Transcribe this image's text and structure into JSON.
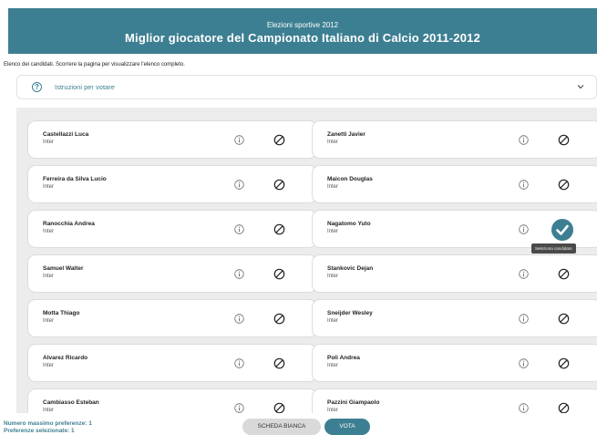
{
  "header": {
    "subtitle": "Elezioni sportive 2012",
    "title": "Miglior giocatore del Campionato Italiano di Calcio 2011-2012"
  },
  "intro_text": "Elenco dei candidati. Scorrere la pagina per visualizzare l'elenco completo.",
  "instructions": {
    "label": "Istruzioni per votare",
    "icon": "question-circle-icon",
    "expand_icon": "chevron-down-icon"
  },
  "candidates": [
    {
      "name": "Castellazzi Luca",
      "team": "Inter",
      "selected": false
    },
    {
      "name": "Zanetti Javier",
      "team": "Inter",
      "selected": false
    },
    {
      "name": "Ferreira da Silva Lucio",
      "team": "Inter",
      "selected": false
    },
    {
      "name": "Maicon Douglas",
      "team": "Inter",
      "selected": false
    },
    {
      "name": "Ranocchia Andrea",
      "team": "Inter",
      "selected": false
    },
    {
      "name": "Nagatomo Yuto",
      "team": "Inter",
      "selected": true
    },
    {
      "name": "Samuel Walter",
      "team": "Inter",
      "selected": false
    },
    {
      "name": "Stankovic Dejan",
      "team": "Inter",
      "selected": false
    },
    {
      "name": "Motta Thiago",
      "team": "Inter",
      "selected": false
    },
    {
      "name": "Sneijder Wesley",
      "team": "Inter",
      "selected": false
    },
    {
      "name": "Alvarez Ricardo",
      "team": "Inter",
      "selected": false
    },
    {
      "name": "Poli Andrea",
      "team": "Inter",
      "selected": false
    },
    {
      "name": "Cambiasso Esteban",
      "team": "Inter",
      "selected": false
    },
    {
      "name": "Pazzini Giampaolo",
      "team": "Inter",
      "selected": false
    }
  ],
  "tooltip": "Seleziona candidato",
  "footer": {
    "max_preferences": "Numero massimo preferenze: 1",
    "selected_preferences": "Preferenze selezionate: 1",
    "blank_button": "SCHEDA BIANCA",
    "vote_button": "VOTA"
  },
  "colors": {
    "accent": "#3d7f92",
    "list_background": "#ececec"
  }
}
